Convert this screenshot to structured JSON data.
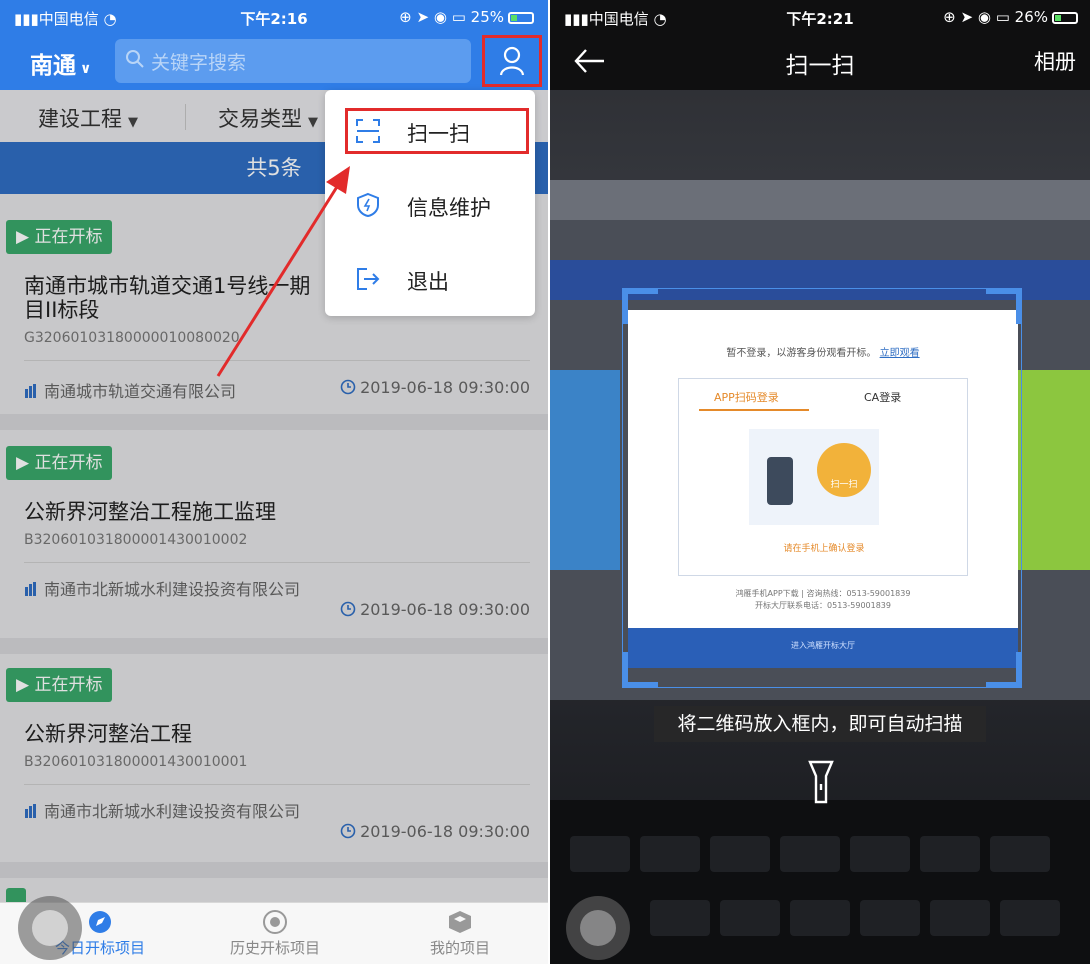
{
  "left": {
    "status_bar": {
      "carrier": "中国电信",
      "time": "下午2:16",
      "battery": "25%"
    },
    "header": {
      "city": "南通",
      "search_placeholder": "关键字搜索"
    },
    "filters": [
      "建设工程",
      "交易类型"
    ],
    "count_text": "共5条",
    "dropdown": {
      "items": [
        "扫一扫",
        "信息维护",
        "退出"
      ]
    },
    "cards": [
      {
        "tag": "正在开标",
        "title_line1": "南通市城市轨道交通1号线一期",
        "title_line2": "目II标段",
        "code": "G32060103180000010080020",
        "org": "南通城市轨道交通有限公司",
        "time": "2019-06-18 09:30:00"
      },
      {
        "tag": "正在开标",
        "title_line1": "公新界河整治工程施工监理",
        "code": "B320601031800001430010002",
        "org": "南通市北新城水利建设投资有限公司",
        "time": "2019-06-18 09:30:00"
      },
      {
        "tag": "正在开标",
        "title_line1": "公新界河整治工程",
        "code": "B320601031800001430010001",
        "org": "南通市北新城水利建设投资有限公司",
        "time": "2019-06-18 09:30:00"
      }
    ],
    "tabbar": [
      "今日开标项目",
      "历史开标项目",
      "我的项目"
    ]
  },
  "right": {
    "status_bar": {
      "carrier": "中国电信",
      "time": "下午2:21",
      "battery": "26%"
    },
    "nav": {
      "title": "扫一扫",
      "album": "相册"
    },
    "web_modal": {
      "tip": "暂不登录，以游客身份观看开标。",
      "tip_link": "立即观看",
      "tab_app": "APP扫码登录",
      "tab_ca": "CA登录",
      "bubble": "扫一扫",
      "hint": "请在手机上确认登录",
      "foot1": "鸿雁手机APP下载 | 咨询热线：0513-59001839",
      "foot2": "开标大厅联系电话：0513-59001839",
      "enter_btn": "进入鸿雁开标大厅"
    },
    "scan_hint": "将二维码放入框内，即可自动扫描"
  },
  "colors": {
    "primary": "#2f7de7",
    "highlight": "#e22b2b",
    "tag_green": "#3aa86a",
    "scan_blue": "#4a8fe8"
  }
}
